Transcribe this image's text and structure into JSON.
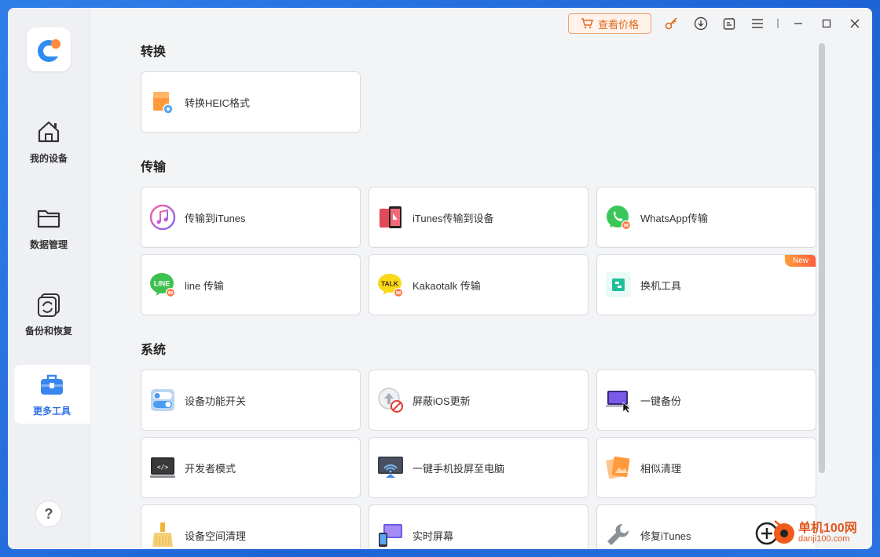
{
  "sidebar": {
    "items": [
      {
        "label": "我的设备",
        "icon": "home-icon"
      },
      {
        "label": "数据管理",
        "icon": "folder-icon"
      },
      {
        "label": "备份和恢复",
        "icon": "backup-restore-icon"
      },
      {
        "label": "更多工具",
        "icon": "toolbox-icon",
        "active": true
      }
    ],
    "help_label": "?"
  },
  "titlebar": {
    "price_label": "查看价格",
    "icons": [
      "key-icon",
      "download-icon",
      "feedback-icon",
      "menu-icon",
      "minimize-icon",
      "maximize-icon",
      "close-icon"
    ]
  },
  "sections": {
    "convert": {
      "title": "转换",
      "items": [
        {
          "label": "转换HEIC格式",
          "icon": "heic-convert-icon"
        }
      ]
    },
    "transfer": {
      "title": "传输",
      "items": [
        {
          "label": "传输到iTunes",
          "icon": "itunes-icon"
        },
        {
          "label": "iTunes传输到设备",
          "icon": "itunes-to-device-icon"
        },
        {
          "label": "WhatsApp传输",
          "icon": "whatsapp-icon"
        },
        {
          "label": "line 传输",
          "icon": "line-icon"
        },
        {
          "label": "Kakaotalk 传输",
          "icon": "kakaotalk-icon"
        },
        {
          "label": "换机工具",
          "icon": "phone-switch-icon",
          "badge": "New"
        }
      ]
    },
    "system": {
      "title": "系统",
      "items": [
        {
          "label": "设备功能开关",
          "icon": "toggle-switch-icon"
        },
        {
          "label": "屏蔽iOS更新",
          "icon": "block-update-icon"
        },
        {
          "label": "一键备份",
          "icon": "one-click-backup-icon"
        },
        {
          "label": "开发者模式",
          "icon": "developer-mode-icon"
        },
        {
          "label": "一键手机投屏至电脑",
          "icon": "screen-cast-icon"
        },
        {
          "label": "相似清理",
          "icon": "similar-photos-icon"
        },
        {
          "label": "设备空间清理",
          "icon": "broom-icon"
        },
        {
          "label": "实时屏幕",
          "icon": "live-screen-icon"
        },
        {
          "label": "修复iTunes",
          "icon": "wrench-icon"
        }
      ]
    }
  },
  "watermark": {
    "title": "单机100网",
    "sub": "danji100.com"
  },
  "colors": {
    "accent": "#2f6fe8",
    "price": "#e0681c",
    "background": "#f3f4f6"
  }
}
